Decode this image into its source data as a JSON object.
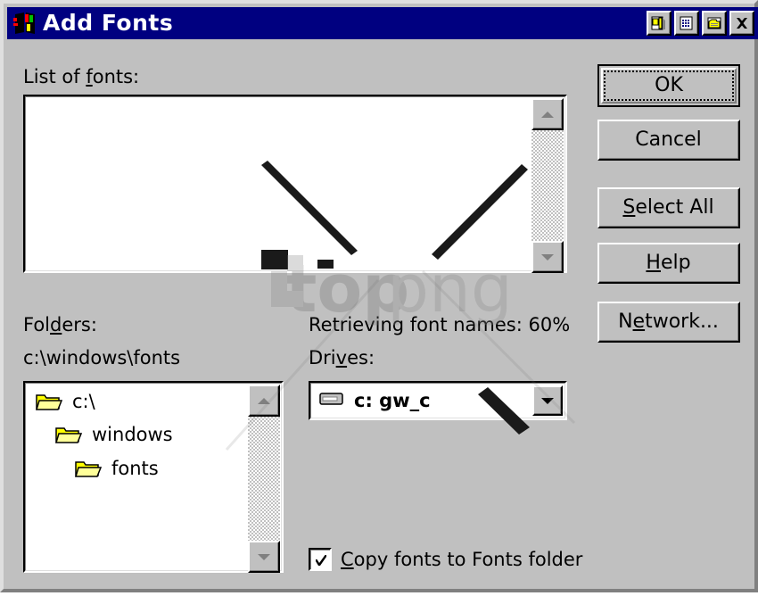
{
  "window": {
    "title": "Add Fonts",
    "icon": "fonts-book-icon",
    "bg_color": "#c0c0c0",
    "titlebar_color": "#000080",
    "titlebar_text_color": "#ffffff"
  },
  "titlebar_buttons": [
    {
      "name": "list-view-button",
      "icon": "list-view-icon"
    },
    {
      "name": "details-view-button",
      "icon": "details-view-icon"
    },
    {
      "name": "up-folder-button",
      "icon": "up-folder-icon"
    },
    {
      "name": "close-button",
      "icon": "close-x-icon",
      "label": "X"
    }
  ],
  "font_list": {
    "label": "List of fonts:",
    "label_accel": "f",
    "items": [],
    "scrollbar": {
      "up_arrow": "scroll-up-arrow-icon",
      "down_arrow": "scroll-down-arrow-icon"
    }
  },
  "status": {
    "text": "Retrieving font names: 60%",
    "percent": 60
  },
  "folders": {
    "label": "Folders:",
    "label_accel": "d",
    "path": "c:\\windows\\fonts",
    "items": [
      {
        "label": "c:\\",
        "icon": "open-folder-icon",
        "indent": 0
      },
      {
        "label": "windows",
        "icon": "open-folder-icon",
        "indent": 1
      },
      {
        "label": "fonts",
        "icon": "open-folder-icon",
        "indent": 2
      }
    ],
    "scrollbar": {
      "up_arrow": "scroll-up-arrow-icon",
      "down_arrow": "scroll-down-arrow-icon"
    }
  },
  "drives": {
    "label": "Drives:",
    "label_accel": "v",
    "selected": "c: gw_c",
    "icon": "hard-drive-icon",
    "dropdown_arrow": "chevron-down-icon"
  },
  "copy_option": {
    "label": "Copy fonts to Fonts folder",
    "label_accel": "C",
    "checked": true
  },
  "buttons": [
    {
      "name": "ok-button",
      "label": "OK",
      "accel": "",
      "default": true
    },
    {
      "name": "cancel-button",
      "label": "Cancel",
      "accel": "",
      "default": false
    },
    {
      "name": "select-all-button",
      "label": "Select All",
      "accel": "S",
      "default": false
    },
    {
      "name": "help-button",
      "label": "Help",
      "accel": "H",
      "default": false
    },
    {
      "name": "network-button",
      "label": "Network...",
      "accel": "e",
      "default": false
    }
  ],
  "watermark": {
    "text_bold": "top",
    "text_light": "png"
  }
}
